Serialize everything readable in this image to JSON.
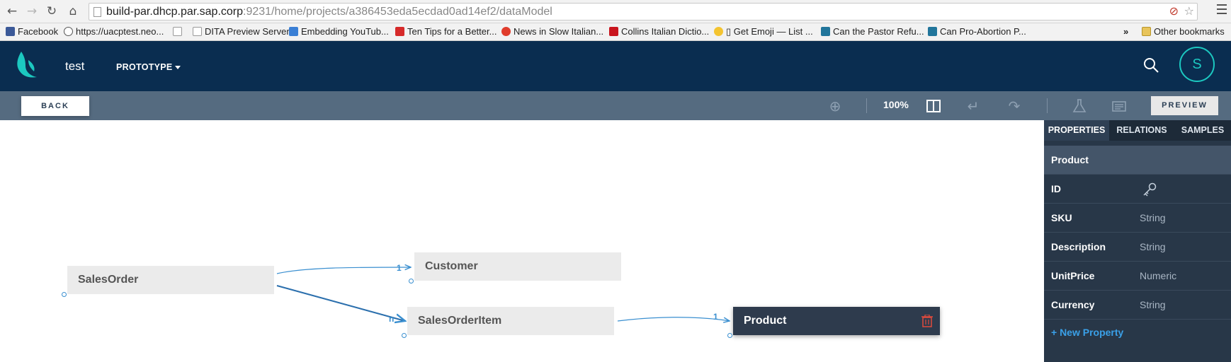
{
  "browser": {
    "url_host": "build-par.dhcp.par.sap.corp",
    "url_path": ":9231/home/projects/a386453eda5ecdad0ad14ef2/dataModel",
    "icons": [
      "back-icon",
      "forward-icon",
      "reload-icon",
      "home-icon",
      "star-icon",
      "menu-icon"
    ]
  },
  "bookmarks": {
    "items": [
      {
        "label": "Facebook",
        "icon_color": "#3b5998"
      },
      {
        "label": "https://uacptest.neo...",
        "icon_color": "#555555"
      },
      {
        "label": "",
        "icon_color": "#cccccc"
      },
      {
        "label": "DITA Preview Server",
        "icon_color": "#cccccc"
      },
      {
        "label": "Embedding YouTub...",
        "icon_color": "#3a7fd5"
      },
      {
        "label": "Ten Tips for a Better...",
        "icon_color": "#d62a2a"
      },
      {
        "label": "News in Slow Italian...",
        "icon_color": "#e03c2c"
      },
      {
        "label": "Collins Italian Dictio...",
        "icon_color": "#c9151e"
      },
      {
        "label": "▯ Get Emoji — List ...",
        "icon_color": "#f4c430"
      },
      {
        "label": "Can the Pastor Refu...",
        "icon_color": "#21759b"
      },
      {
        "label": "Can Pro-Abortion P...",
        "icon_color": "#21759b"
      }
    ],
    "overflow": "»",
    "other": "Other bookmarks"
  },
  "app": {
    "project_name": "test",
    "prototype_menu": "PROTOTYPE",
    "avatar_initial": "S",
    "accent_color": "#1cc8c0",
    "header_color": "#0a2d50"
  },
  "toolbar": {
    "back_label": "BACK",
    "zoom_label": "100%",
    "preview_label": "PREVIEW",
    "icons": [
      "add-icon",
      "layout-toggle-icon",
      "undo-icon",
      "redo-icon",
      "flask-icon",
      "data-icon"
    ]
  },
  "canvas": {
    "entities": [
      {
        "name": "SalesOrder"
      },
      {
        "name": "Customer"
      },
      {
        "name": "SalesOrderItem"
      },
      {
        "name": "Product",
        "selected": true
      }
    ],
    "relations": [
      {
        "from": "SalesOrder",
        "to": "Customer",
        "cardinality": "1"
      },
      {
        "from": "SalesOrder",
        "to": "SalesOrderItem",
        "cardinality": "n"
      },
      {
        "from": "SalesOrderItem",
        "to": "Product",
        "cardinality": "1"
      }
    ]
  },
  "panel": {
    "tabs": [
      {
        "label": "PROPERTIES",
        "active": true
      },
      {
        "label": "RELATIONS",
        "active": false
      },
      {
        "label": "SAMPLES",
        "active": false
      }
    ],
    "entity_title": "Product",
    "properties": [
      {
        "name": "ID",
        "type": "",
        "is_key": true
      },
      {
        "name": "SKU",
        "type": "String"
      },
      {
        "name": "Description",
        "type": "String"
      },
      {
        "name": "UnitPrice",
        "type": "Numeric"
      },
      {
        "name": "Currency",
        "type": "String"
      }
    ],
    "new_property_label": "+ New Property"
  }
}
